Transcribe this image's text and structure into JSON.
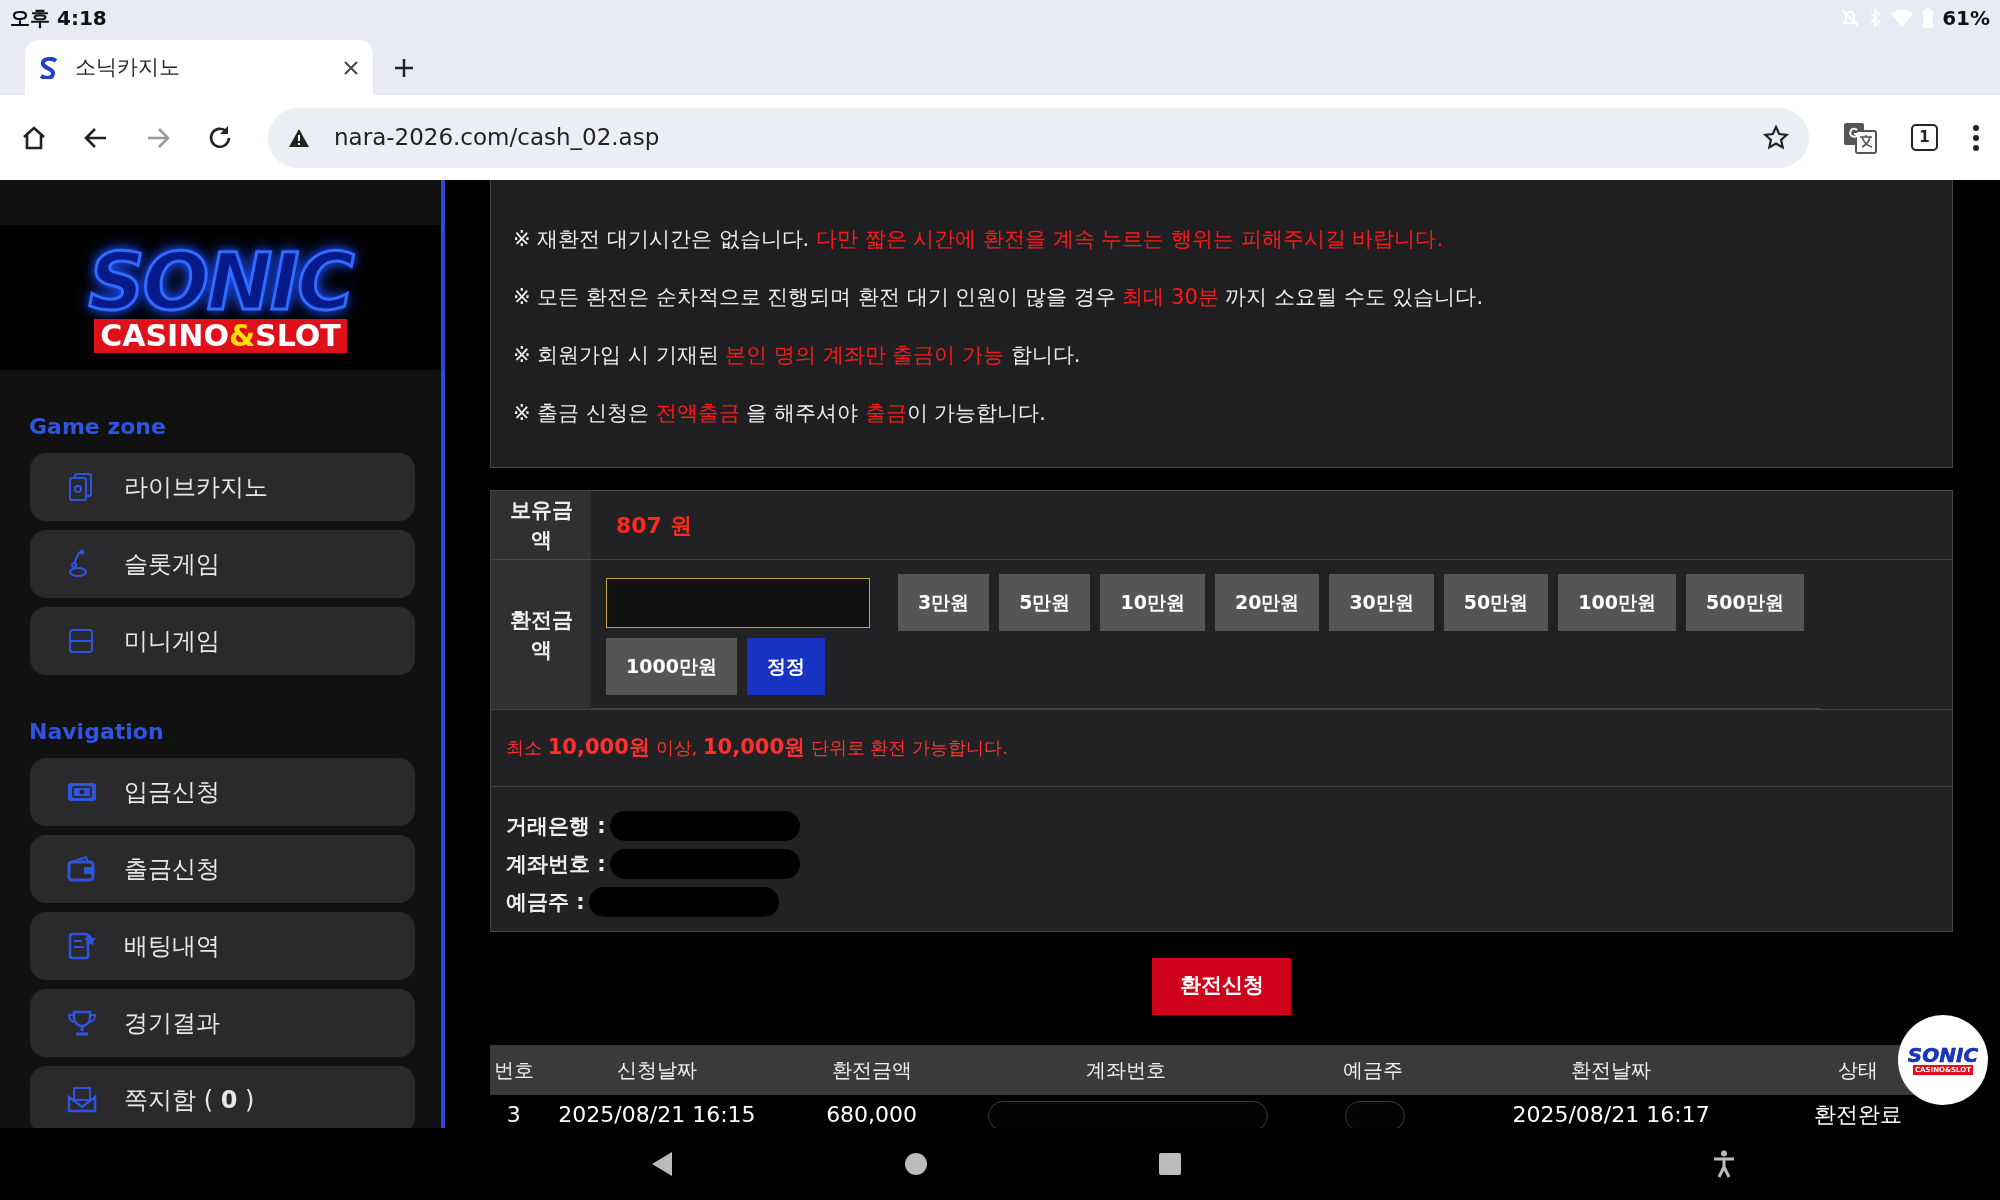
{
  "status_bar": {
    "time": "오후 4:18",
    "battery": "61%"
  },
  "browser": {
    "tab": {
      "title": "소닉카지노",
      "selected": true
    },
    "url": "nara-2026.com/cash_02.asp",
    "tab_count": "1",
    "forward_disabled": true
  },
  "logo": {
    "title": "SONIC",
    "subtitle_parts": [
      {
        "text": "CASINO",
        "accent": false
      },
      {
        "text": "&",
        "accent": true
      },
      {
        "text": "SLOT",
        "accent": false
      }
    ]
  },
  "sidebar": {
    "sections": [
      {
        "title": "Game zone",
        "items": [
          {
            "label": "라이브카지노"
          },
          {
            "label": "슬롯게임"
          },
          {
            "label": "미니게임"
          }
        ]
      },
      {
        "title": "Navigation",
        "items": [
          {
            "label": "입금신청"
          },
          {
            "label": "출금신청"
          },
          {
            "label": "배팅내역"
          },
          {
            "label": "경기결과"
          },
          {
            "label": "쪽지함 ( **0** )"
          }
        ]
      }
    ]
  },
  "notices": [
    [
      {
        "text": "※ 재환전 대기시간은 없습니다. ",
        "highlight": false
      },
      {
        "text": "다만 짧은 시간에 환전을 계속 누르는 행위는 피해주시길 바랍니다.",
        "highlight": true
      }
    ],
    [
      {
        "text": "※ 모든 환전은 순차적으로 진행되며 환전 대기 인원이 많을 경우 ",
        "highlight": false
      },
      {
        "text": "최대 30분",
        "highlight": true
      },
      {
        "text": " 까지 소요될 수도 있습니다.",
        "highlight": false
      }
    ],
    [
      {
        "text": "※ 회원가입 시 기재된 ",
        "highlight": false
      },
      {
        "text": "본인 명의 계좌만 출금이 가능",
        "highlight": true
      },
      {
        "text": " 합니다.",
        "highlight": false
      }
    ],
    [
      {
        "text": "※ 출금 신청은 ",
        "highlight": false
      },
      {
        "text": "전액출금",
        "highlight": true
      },
      {
        "text": " 을 해주셔야 ",
        "highlight": false
      },
      {
        "text": "출금",
        "highlight": true
      },
      {
        "text": "이 가능합니다.",
        "highlight": false
      }
    ]
  ],
  "form": {
    "balance_label": "보유금액",
    "balance": "807 원",
    "amount_label": "환전금액",
    "amount_buttons": [
      {
        "label": "3만원",
        "kind": "amount"
      },
      {
        "label": "5만원",
        "kind": "amount"
      },
      {
        "label": "10만원",
        "kind": "amount"
      },
      {
        "label": "20만원",
        "kind": "amount"
      },
      {
        "label": "30만원",
        "kind": "amount"
      },
      {
        "label": "50만원",
        "kind": "amount"
      },
      {
        "label": "100만원",
        "kind": "amount"
      },
      {
        "label": "500만원",
        "kind": "amount"
      },
      {
        "label": "1000만원",
        "kind": "amount"
      },
      {
        "label": "정정",
        "kind": "reset"
      }
    ],
    "note": "최소 **10,000원** 이상, **10,000원**  단위로 환전 가능합니다.",
    "bank_info": [
      {
        "label": "거래은행 :",
        "redacted": true
      },
      {
        "label": "계좌번호 :",
        "redacted": true
      },
      {
        "label": "예금주 :",
        "redacted": true
      }
    ]
  },
  "submit_button": "환전신청",
  "table": {
    "columns": [
      "번호",
      "신청날짜",
      "환전금액",
      "계좌번호",
      "예금주",
      "환전날짜",
      "상태"
    ],
    "rows": [
      [
        {
          "text": "3",
          "redacted": false
        },
        {
          "text": "2025/08/21 16:15",
          "redacted": false
        },
        {
          "text": "680,000",
          "redacted": false
        },
        {
          "redacted": true
        },
        {
          "redacted": true
        },
        {
          "text": "2025/08/21 16:17",
          "redacted": false
        },
        {
          "text": "환전완료",
          "redacted": false
        }
      ]
    ]
  },
  "floating_badge": {
    "title": "SONIC",
    "subtitle": "CASINO&SLOT"
  }
}
